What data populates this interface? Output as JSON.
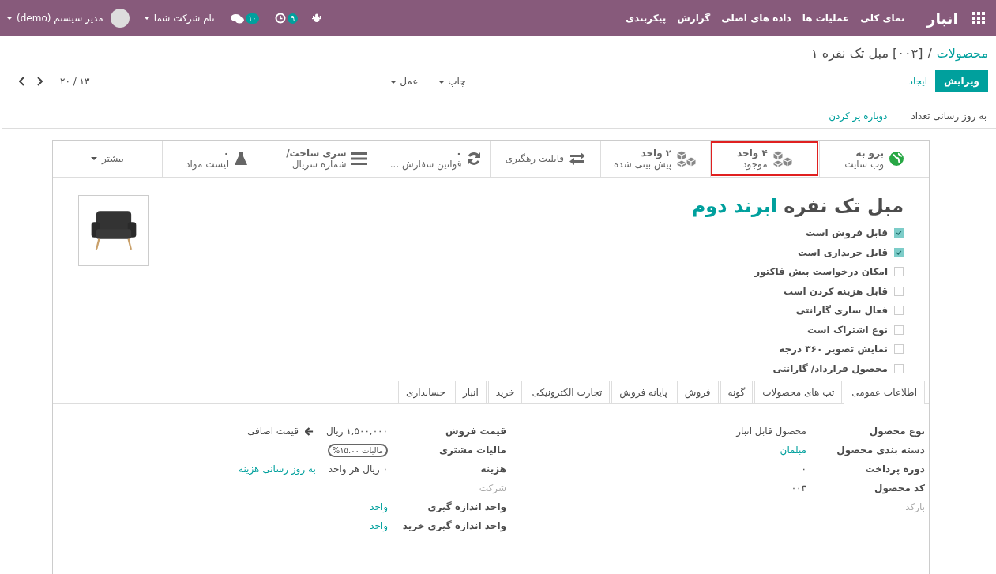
{
  "navbar": {
    "app": "انبار",
    "menu": [
      "نمای کلی",
      "عملیات ها",
      "داده های اصلی",
      "گزارش",
      "پیکربندی"
    ],
    "activity_count": "۹",
    "message_count": "۱۰",
    "company": "نام شرکت شما",
    "user": "مدیر سیستم (demo)"
  },
  "breadcrumb": {
    "parent": "محصولات",
    "separator": "/",
    "current": "[۰۰۳] مبل تک نفره ۱"
  },
  "buttons": {
    "edit": "ویرایش",
    "create": "ایجاد"
  },
  "dropdowns": [
    "چاپ",
    "عمل"
  ],
  "pager": "۱۳ / ۲۰",
  "header_actions": [
    "به روز رسانی تعداد",
    "دوباره پر کردن"
  ],
  "smart_buttons": [
    {
      "kind": "globe",
      "lines": [
        "برو به",
        "وب سایت"
      ],
      "highlighted": false
    },
    {
      "kind": "cubes",
      "lines": [
        "۴ واحد",
        "موجود"
      ],
      "highlighted": true
    },
    {
      "kind": "cubes",
      "lines": [
        "۲ واحد",
        "پیش بینی شده"
      ],
      "highlighted": false
    },
    {
      "kind": "exchange",
      "lines": [
        "قابلیت رهگیری"
      ],
      "highlighted": false
    },
    {
      "kind": "refresh",
      "lines": [
        "۰",
        "قوانین سفارش ..."
      ],
      "highlighted": false
    },
    {
      "kind": "bars",
      "lines": [
        "سری ساخت/",
        "شماره سریال"
      ],
      "highlighted": false
    },
    {
      "kind": "flask",
      "lines": [
        "۰",
        "لیست مواد"
      ],
      "highlighted": false
    },
    {
      "kind": "more",
      "lines": [
        "بیشتر"
      ],
      "highlighted": false
    }
  ],
  "title": {
    "text": "مبل تک نفره",
    "highlight": "ابرند دوم"
  },
  "options": [
    {
      "label": "قابل فروش است",
      "checked": true
    },
    {
      "label": "قابل خریداری است",
      "checked": true
    },
    {
      "label": "امکان درخواست پیش فاکتور",
      "checked": false
    },
    {
      "label": "قابل هزینه کردن است",
      "checked": false
    },
    {
      "label": "فعال سازی گارانتی",
      "checked": false
    },
    {
      "label": "نوع اشتراک است",
      "checked": false
    },
    {
      "label": "نمایش تصویر ۳۶۰ درجه",
      "checked": false
    },
    {
      "label": "محصول قرارداد/ گارانتی",
      "checked": false
    }
  ],
  "tabs": [
    {
      "label": "اطلاعات عمومی",
      "selected": true
    },
    {
      "label": "تب های محصولات",
      "selected": false
    },
    {
      "label": "گونه",
      "selected": false
    },
    {
      "label": "فروش",
      "selected": false
    },
    {
      "label": "پایانه فروش",
      "selected": false
    },
    {
      "label": "تجارت الکترونیکی",
      "selected": false
    },
    {
      "label": "خرید",
      "selected": false
    },
    {
      "label": "انبار",
      "selected": false
    },
    {
      "label": "حسابداری",
      "selected": false
    }
  ],
  "general_fields": [
    {
      "kind": "text",
      "label": "نوع محصول",
      "value": "محصول قابل انبار"
    },
    {
      "kind": "link",
      "label": "دسته بندی محصول",
      "value": "مبلمان"
    },
    {
      "kind": "text",
      "label": "دوره پرداخت",
      "value": "۰"
    },
    {
      "kind": "text",
      "label": "کد محصول",
      "value": "۰۰۳"
    },
    {
      "kind": "empty",
      "label": "بارکد"
    }
  ],
  "price_fields": [
    {
      "kind": "price",
      "label": "قیمت فروش",
      "value": "۱,۵۰۰,۰۰۰ ریال",
      "extra": "قیمت اضافی"
    },
    {
      "kind": "tag",
      "label": "مالیات مشتری",
      "value": "مالیات ۱۵.۰۰%"
    },
    {
      "kind": "cost",
      "label": "هزینه",
      "value": "۰ ریال هر واحد",
      "extra": "به روز رسانی هزینه"
    },
    {
      "kind": "empty",
      "label": "شرکت"
    },
    {
      "kind": "link",
      "label": "واحد اندازه گیری",
      "value": "واحد"
    },
    {
      "kind": "link",
      "label": "واحد اندازه گیری خرید",
      "value": "واحد"
    }
  ]
}
